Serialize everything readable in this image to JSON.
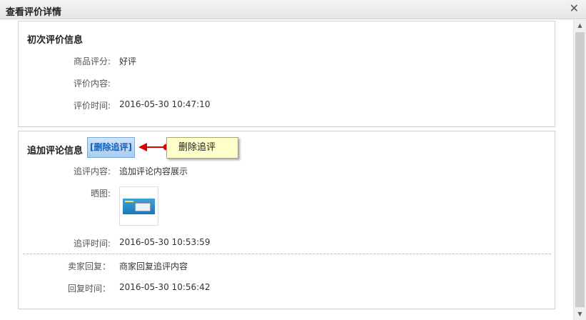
{
  "dialog": {
    "title": "查看评价详情",
    "close_symbol": "✕"
  },
  "initial_review": {
    "title": "初次评价信息",
    "rating_label": "商品评分:",
    "rating_value": "好评",
    "content_label": "评价内容:",
    "content_value": "",
    "time_label": "评价时间:",
    "time_value": "2016-05-30 10:47:10"
  },
  "followup_review": {
    "title": "追加评论信息",
    "delete_button_label": "[删除追评]",
    "callout_text": "删除追评",
    "content_label": "追评内容:",
    "content_value": "追加评论内容展示",
    "photo_label": "晒图:",
    "time_label": "追评时间:",
    "time_value": "2016-05-30 10:53:59",
    "seller_reply_label": "卖家回复：",
    "seller_reply_value": "商家回复追评内容",
    "reply_time_label": "回复时间：",
    "reply_time_value": "2016-05-30 10:56:42"
  },
  "colors": {
    "callout_bg": "#ffffcc",
    "arrow_red": "#e00000",
    "button_text": "#1a5fb4"
  }
}
